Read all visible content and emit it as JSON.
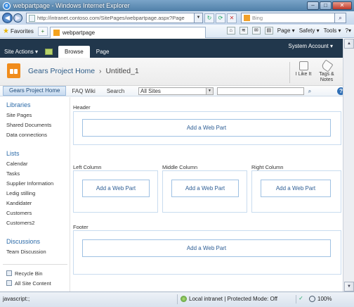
{
  "window": {
    "title": "webpartpage - Windows Internet Explorer",
    "url": "http://intranet.contoso.com/SitePages/webpartpage.aspx?Page",
    "search_placeholder": "Bing",
    "minimize": "–",
    "maximize": "□",
    "close": "✕"
  },
  "favorites_bar": {
    "favorites_label": "Favorites",
    "tab_label": "webpartpage",
    "page_menu": "Page ▾",
    "safety_menu": "Safety ▾",
    "tools_menu": "Tools ▾",
    "help_menu": "?▾"
  },
  "ribbon": {
    "site_actions": "Site Actions ▾",
    "tabs": [
      {
        "label": "Browse"
      },
      {
        "label": "Page"
      }
    ],
    "account": "System Account ▾"
  },
  "header": {
    "site_name": "Gears Project Home",
    "separator": "›",
    "page_name": "Untitled_1",
    "like_label": "I Like It",
    "tags_label_line1": "Tags &",
    "tags_label_line2": "Notes"
  },
  "topnav": {
    "items": [
      {
        "label": "Gears Project Home"
      },
      {
        "label": "FAQ Wiki"
      },
      {
        "label": "Search"
      }
    ],
    "scope_value": "All Sites",
    "search_value": ""
  },
  "leftnav": {
    "libraries_heading": "Libraries",
    "libraries": [
      {
        "label": "Site Pages"
      },
      {
        "label": "Shared Documents"
      },
      {
        "label": "Data connections"
      }
    ],
    "lists_heading": "Lists",
    "lists": [
      {
        "label": "Calendar"
      },
      {
        "label": "Tasks"
      },
      {
        "label": "Supplier Information"
      },
      {
        "label": "Ledig stilling"
      },
      {
        "label": "Kandidater"
      },
      {
        "label": "Customers"
      },
      {
        "label": "Customers2"
      }
    ],
    "discussions_heading": "Discussions",
    "discussions": [
      {
        "label": "Team Discussion"
      }
    ],
    "recycle_bin": "Recycle Bin",
    "all_site_content": "All Site Content"
  },
  "zones": {
    "header_label": "Header",
    "left_label": "Left Column",
    "middle_label": "Middle Column",
    "right_label": "Right Column",
    "footer_label": "Footer",
    "add_web_part": "Add a Web Part"
  },
  "statusbar": {
    "status_text": "javascript:;",
    "zone_text": "Local intranet | Protected Mode: Off",
    "zoom": "100%"
  }
}
